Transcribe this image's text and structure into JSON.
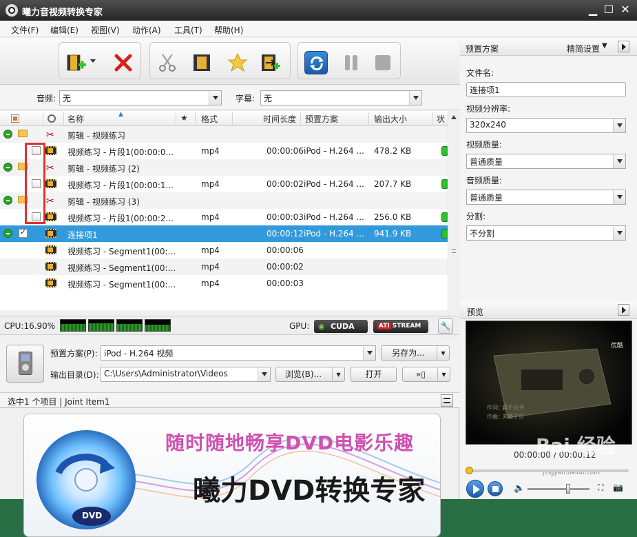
{
  "app": {
    "title": "曦力音视频转换专家"
  },
  "menu": [
    "文件(F)",
    "编辑(E)",
    "视图(V)",
    "动作(A)",
    "工具(T)",
    "帮助(H)"
  ],
  "filters": {
    "audio_label": "音频:",
    "audio_value": "无",
    "subtitle_label": "字幕:",
    "subtitle_value": "无"
  },
  "columns": {
    "name": "名称",
    "star": "★",
    "format": "格式",
    "duration": "时间长度",
    "preset": "预置方案",
    "size": "输出大小",
    "status": "状"
  },
  "rows": [
    {
      "kind": "group",
      "name": "剪辑 - 视频练习"
    },
    {
      "kind": "item",
      "name": "视频练习 - 片段1(00:00:0...",
      "format": "mp4",
      "duration": "00:00:06",
      "preset": "iPod - H.264 ...",
      "size": "478.2 KB"
    },
    {
      "kind": "group",
      "name": "剪辑 - 视频练习 (2)"
    },
    {
      "kind": "item",
      "name": "视频练习 - 片段1(00:00:1...",
      "format": "mp4",
      "duration": "00:00:02",
      "preset": "iPod - H.264 ...",
      "size": "207.7 KB"
    },
    {
      "kind": "group",
      "name": "剪辑 - 视频练习 (3)"
    },
    {
      "kind": "item",
      "name": "视频练习 - 片段1(00:00:2...",
      "format": "mp4",
      "duration": "00:00:03",
      "preset": "iPod - H.264 ...",
      "size": "256.0 KB"
    },
    {
      "kind": "join",
      "name": "连接项1",
      "format": "",
      "duration": "00:00:12",
      "preset": "iPod - H.264 ...",
      "size": "941.9 KB"
    },
    {
      "kind": "seg",
      "name": "视频练习 - Segment1(00:...",
      "format": "mp4",
      "duration": "00:00:06"
    },
    {
      "kind": "seg",
      "name": "视频练习 - Segment1(00:...",
      "format": "mp4",
      "duration": "00:00:02"
    },
    {
      "kind": "seg",
      "name": "视频练习 - Segment1(00:...",
      "format": "mp4",
      "duration": "00:00:03"
    }
  ],
  "cpu": {
    "label": "CPU:16.90%",
    "gpu_label": "GPU:",
    "cuda": "CUDA",
    "stream": "STREAM",
    "ati": "ATI"
  },
  "output": {
    "preset_label": "预置方案(P):",
    "preset_value": "iPod - H.264 视频",
    "save_as": "另存为...",
    "dir_label": "输出目录(D):",
    "dir_value": "C:\\Users\\Administrator\\Videos",
    "browse": "浏览(B)...",
    "open": "打开"
  },
  "status": {
    "text": "选中1 个项目 | Joint Item1"
  },
  "banner": {
    "line1": "随时随地畅享DVD电影乐趣",
    "line2": "曦力DVD转换专家",
    "dvd": "DVD"
  },
  "right": {
    "preset_title": "预置方案",
    "advanced": "精简设置",
    "filename_label": "文件名:",
    "filename_value": "连接项1",
    "resolution_label": "视频分辨率:",
    "resolution_value": "320x240",
    "vquality_label": "视频质量:",
    "vquality_value": "普通质量",
    "aquality_label": "音频质量:",
    "aquality_value": "普通质量",
    "split_label": "分割:",
    "split_value": "不分割",
    "preview_title": "预览",
    "time": "00:00:00 / 00:00:12",
    "caption_top": "优酷",
    "caption_a": "作词：",
    "caption_b": "作曲：",
    "caption_c": "晨于光书",
    "caption_d": "天籁子乐",
    "watermark": "Bai 经验",
    "watermark_url": "jingyan.baidu.com"
  }
}
